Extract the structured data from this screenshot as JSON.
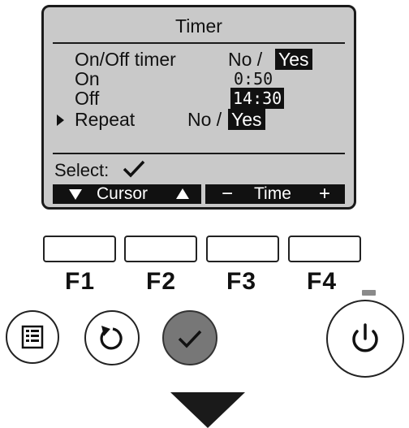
{
  "screen": {
    "title": "Timer",
    "rows": [
      {
        "label": "On/Off timer",
        "no": "No /",
        "yes": "Yes"
      },
      {
        "label": "On",
        "value": "0:50"
      },
      {
        "label": "Off",
        "value": "14:30"
      },
      {
        "label": "Repeat",
        "no": "No /",
        "yes": "Yes"
      }
    ],
    "select_label": "Select:",
    "softkeys": {
      "left_label": "Cursor",
      "right_label": "Time",
      "right_minus": "−",
      "right_plus": "+"
    }
  },
  "function_keys": [
    "F1",
    "F2",
    "F3",
    "F4"
  ],
  "icons": {
    "cursor": "triangle-right-icon",
    "select": "checkmark-icon",
    "menu": "menu-list-icon",
    "return": "return-icon",
    "confirm": "checkmark-icon",
    "power": "power-icon",
    "next": "arrow-down-icon"
  },
  "colors": {
    "lcd_background": "#c9c9c9",
    "highlight": "#111111",
    "confirm_button": "#777777",
    "power_led": "#8a8a8a"
  }
}
